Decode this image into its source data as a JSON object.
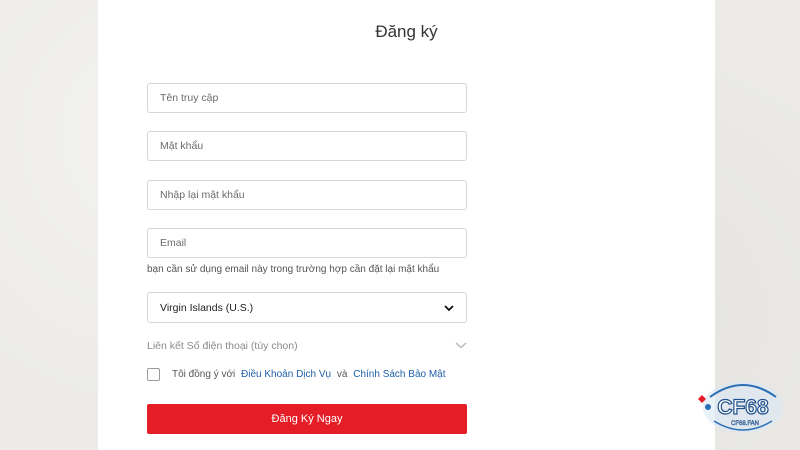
{
  "form": {
    "title": "Đăng ký",
    "username_placeholder": "Tên truy cập",
    "password_placeholder": "Mật khẩu",
    "confirm_password_placeholder": "Nhập lại mật khẩu",
    "email_placeholder": "Email",
    "email_hint": "bạn cần sử dụng email này trong trường hợp cần đặt lại mật khẩu",
    "country_selected": "Virgin Islands (U.S.)",
    "phone_link_label": "Liên kết Số điện thoại (tùy chọn)",
    "agree_prefix": "Tôi đồng ý với",
    "terms_link": "Điều Khoản Dịch Vụ",
    "agree_and": "và",
    "privacy_link": "Chính Sách Bảo Mật",
    "submit_label": "Đăng Ký Ngay"
  },
  "logo": {
    "text": "CF68",
    "subtext": "CF68.FAN"
  },
  "colors": {
    "accent": "#e41d26",
    "link": "#1f5fa8",
    "background": "#ecebe7",
    "panel": "#ffffff"
  }
}
